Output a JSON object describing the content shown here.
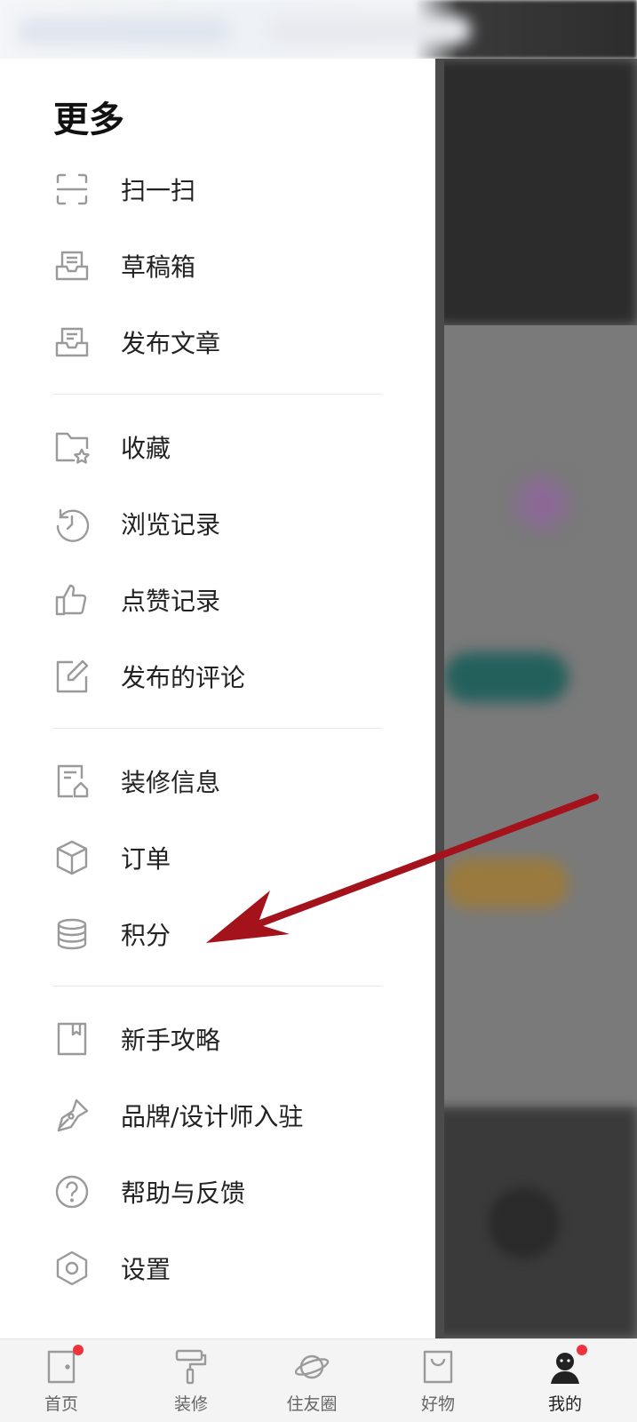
{
  "drawer": {
    "title": "更多",
    "groups": [
      [
        {
          "label": "扫一扫",
          "icon": "scan-icon"
        },
        {
          "label": "草稿箱",
          "icon": "drafts-tray-icon"
        },
        {
          "label": "发布文章",
          "icon": "publish-tray-icon"
        }
      ],
      [
        {
          "label": "收藏",
          "icon": "folder-star-icon"
        },
        {
          "label": "浏览记录",
          "icon": "history-icon"
        },
        {
          "label": "点赞记录",
          "icon": "thumbs-up-icon"
        },
        {
          "label": "发布的评论",
          "icon": "edit-comment-icon"
        }
      ],
      [
        {
          "label": "装修信息",
          "icon": "renovation-doc-icon"
        },
        {
          "label": "订单",
          "icon": "box-icon"
        },
        {
          "label": "积分",
          "icon": "coins-icon"
        }
      ],
      [
        {
          "label": "新手攻略",
          "icon": "bookmark-book-icon"
        },
        {
          "label": "品牌/设计师入驻",
          "icon": "pen-nib-icon"
        },
        {
          "label": "帮助与反馈",
          "icon": "help-icon"
        },
        {
          "label": "设置",
          "icon": "settings-hex-icon"
        }
      ]
    ]
  },
  "tabbar": {
    "tabs": [
      {
        "label": "首页",
        "icon": "home-door-icon",
        "badge": true
      },
      {
        "label": "装修",
        "icon": "paint-roller-icon",
        "badge": false
      },
      {
        "label": "住友圈",
        "icon": "planet-icon",
        "badge": false
      },
      {
        "label": "好物",
        "icon": "shopping-bag-icon",
        "badge": false
      },
      {
        "label": "我的",
        "icon": "profile-icon",
        "badge": true
      }
    ],
    "active_index": 4
  },
  "colors": {
    "badge": "#f0323c",
    "annotation_arrow": "#a4121c",
    "icon_gray": "#9a9a9a"
  }
}
